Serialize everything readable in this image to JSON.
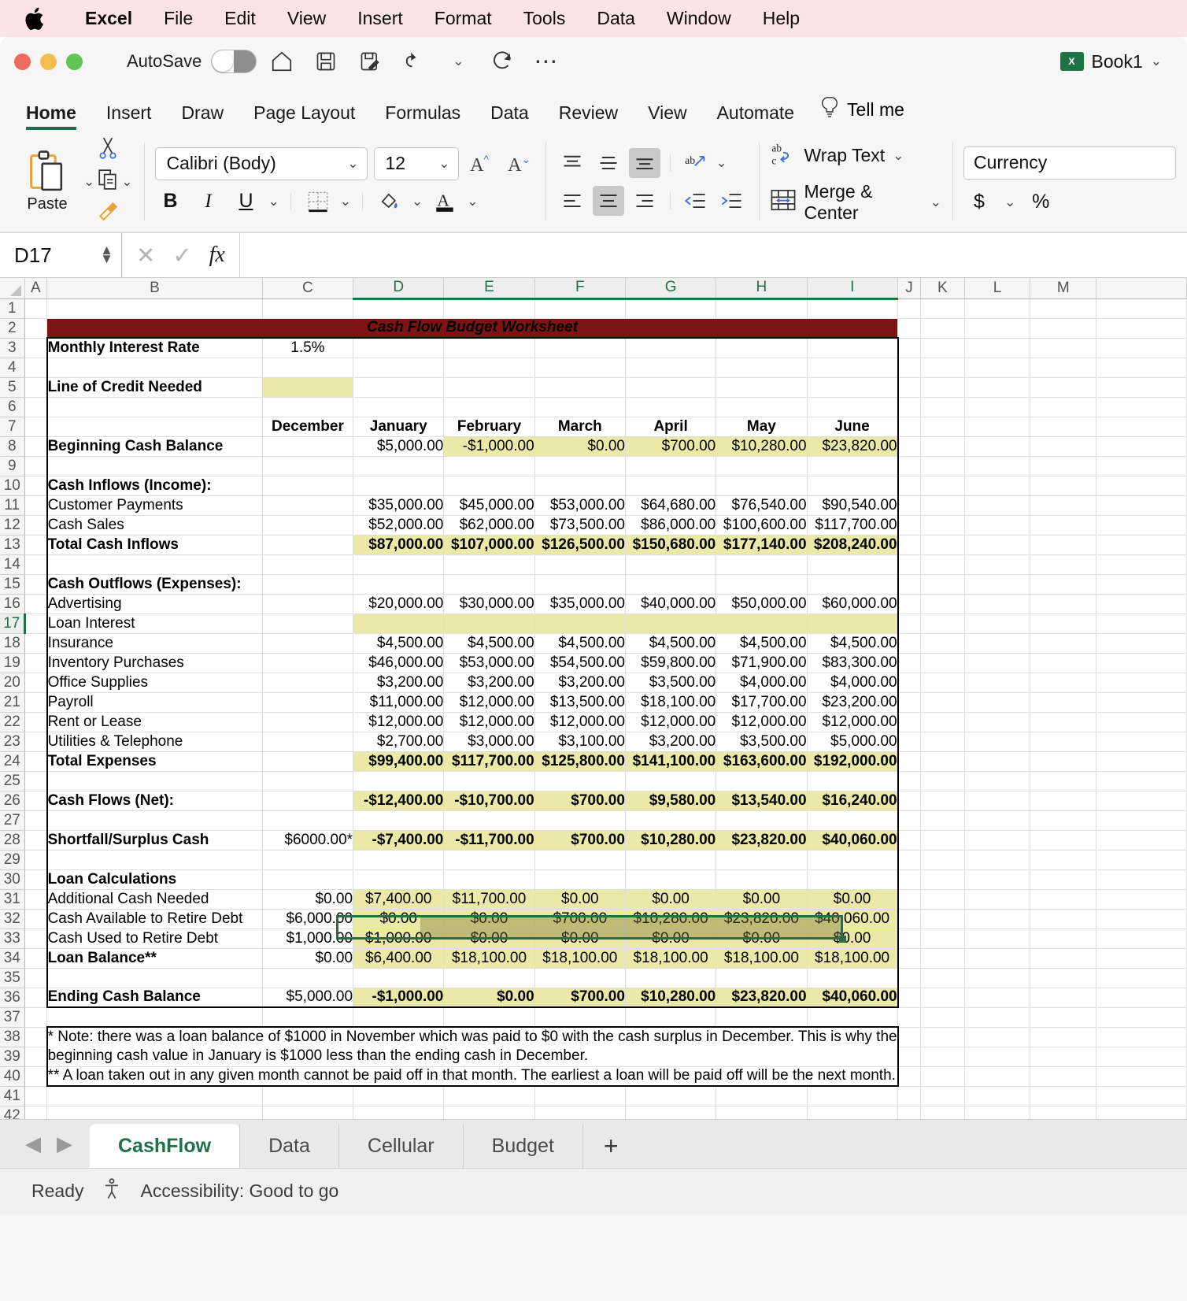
{
  "macmenu": {
    "apple_icon": "apple-logo-icon",
    "items": [
      "Excel",
      "File",
      "Edit",
      "View",
      "Insert",
      "Format",
      "Tools",
      "Data",
      "Window",
      "Help"
    ]
  },
  "quick_access": {
    "autosave_label": "AutoSave",
    "autosave_state": "off",
    "icons": [
      "home-icon",
      "save-icon",
      "save-as-icon",
      "undo-icon",
      "undo-dropdown-icon",
      "redo-icon",
      "more-options-icon"
    ],
    "workbook_name": "Book1",
    "workbook_badge": "X",
    "workbook_dropdown": "chevron-down-icon"
  },
  "ribbon": {
    "tabs": [
      "Home",
      "Insert",
      "Draw",
      "Page Layout",
      "Formulas",
      "Data",
      "Review",
      "View",
      "Automate"
    ],
    "active_tab": "Home",
    "tell_me": "Tell me",
    "clipboard": {
      "paste_label": "Paste",
      "cut": "scissors-icon",
      "copy": "copy-icon",
      "format_painter": "format-painter-icon"
    },
    "font": {
      "family": "Calibri (Body)",
      "size": "12",
      "grow": "A^",
      "shrink": "Av",
      "bold": "B",
      "italic": "I",
      "underline": "U",
      "borders": "borders-icon",
      "fill": "fill-color-icon",
      "font_color": "font-color-icon"
    },
    "alignment": {
      "top": "align-top-icon",
      "middle": "align-middle-icon",
      "bottom": "align-bottom-icon",
      "left": "align-left-icon",
      "center": "align-center-icon",
      "right": "align-right-icon",
      "orientation": "text-orientation-icon",
      "decrease_indent": "decrease-indent-icon",
      "increase_indent": "increase-indent-icon",
      "wrap_text": "Wrap Text",
      "merge_center": "Merge & Center"
    },
    "number": {
      "format": "Currency",
      "accounting": "$",
      "percent": "%"
    }
  },
  "formula_bar": {
    "name_box": "D17",
    "cancel": "cancel-icon",
    "enter": "confirm-icon",
    "fx": "fx",
    "value": ""
  },
  "grid": {
    "columns": [
      "A",
      "B",
      "C",
      "D",
      "E",
      "F",
      "G",
      "H",
      "I",
      "J",
      "K",
      "L",
      "M"
    ],
    "selected_columns": [
      "D",
      "E",
      "F",
      "G",
      "H",
      "I"
    ],
    "selected_row": "17",
    "title": "Cash Flow Budget Worksheet",
    "row_numbers": [
      "1",
      "2",
      "3",
      "4",
      "5",
      "6",
      "7",
      "8",
      "9",
      "10",
      "11",
      "12",
      "13",
      "14",
      "15",
      "16",
      "17",
      "18",
      "19",
      "20",
      "21",
      "22",
      "23",
      "24",
      "25",
      "26",
      "27",
      "28",
      "29",
      "30",
      "31",
      "32",
      "33",
      "34",
      "35",
      "36",
      "37",
      "38",
      "39",
      "40",
      "41",
      "42"
    ],
    "labels": {
      "monthly_interest_rate": "Monthly Interest Rate",
      "line_of_credit_needed": "Line of Credit Needed",
      "beginning_cash_balance": "Beginning Cash Balance",
      "cash_inflows": "Cash Inflows (Income):",
      "customer_payments": "Customer Payments",
      "cash_sales": "Cash Sales",
      "total_cash_inflows": "Total Cash Inflows",
      "cash_outflows": "Cash Outflows (Expenses):",
      "advertising": "Advertising",
      "loan_interest": "Loan Interest",
      "insurance": "Insurance",
      "inventory_purchases": "Inventory Purchases",
      "office_supplies": "Office Supplies",
      "payroll": "Payroll",
      "rent_or_lease": "Rent or Lease",
      "utilities_telephone": "Utilities & Telephone",
      "total_expenses": "Total Expenses",
      "cash_flows_net": "Cash Flows (Net):",
      "shortfall_surplus": "Shortfall/Surplus Cash",
      "loan_calculations": "Loan Calculations",
      "additional_cash_needed": "Additional Cash Needed",
      "cash_available_retire": "Cash Available to Retire Debt",
      "cash_used_retire": "Cash Used to Retire Debt",
      "loan_balance": "Loan Balance**",
      "ending_cash_balance": "Ending Cash Balance"
    },
    "month_headers": [
      "December",
      "January",
      "February",
      "March",
      "April",
      "May",
      "June"
    ],
    "interest_rate_value": "1.5%",
    "notes": [
      "* Note: there was a loan balance of $1000 in November which was paid to $0 with the cash surplus in December. This is why the",
      "beginning cash value in January is $1000 less than the ending cash in December.",
      "** A loan taken out in any given month cannot be paid off in that month. The earliest a loan will be paid off will be the next month."
    ]
  },
  "chart_data": {
    "type": "table",
    "title": "Cash Flow Budget Worksheet",
    "columns": [
      "December",
      "January",
      "February",
      "March",
      "April",
      "May",
      "June"
    ],
    "rows": [
      {
        "label": "Beginning Cash Balance",
        "values": [
          "",
          "$5,000.00",
          "-$1,000.00",
          "$0.00",
          "$700.00",
          "$10,280.00",
          "$23,820.00"
        ]
      },
      {
        "label": "Customer Payments",
        "values": [
          "",
          "$35,000.00",
          "$45,000.00",
          "$53,000.00",
          "$64,680.00",
          "$76,540.00",
          "$90,540.00"
        ]
      },
      {
        "label": "Cash Sales",
        "values": [
          "",
          "$52,000.00",
          "$62,000.00",
          "$73,500.00",
          "$86,000.00",
          "$100,600.00",
          "$117,700.00"
        ]
      },
      {
        "label": "Total Cash Inflows",
        "values": [
          "",
          "$87,000.00",
          "$107,000.00",
          "$126,500.00",
          "$150,680.00",
          "$177,140.00",
          "$208,240.00"
        ]
      },
      {
        "label": "Advertising",
        "values": [
          "",
          "$20,000.00",
          "$30,000.00",
          "$35,000.00",
          "$40,000.00",
          "$50,000.00",
          "$60,000.00"
        ]
      },
      {
        "label": "Loan Interest",
        "values": [
          "",
          "",
          "",
          "",
          "",
          "",
          ""
        ]
      },
      {
        "label": "Insurance",
        "values": [
          "",
          "$4,500.00",
          "$4,500.00",
          "$4,500.00",
          "$4,500.00",
          "$4,500.00",
          "$4,500.00"
        ]
      },
      {
        "label": "Inventory Purchases",
        "values": [
          "",
          "$46,000.00",
          "$53,000.00",
          "$54,500.00",
          "$59,800.00",
          "$71,900.00",
          "$83,300.00"
        ]
      },
      {
        "label": "Office Supplies",
        "values": [
          "",
          "$3,200.00",
          "$3,200.00",
          "$3,200.00",
          "$3,500.00",
          "$4,000.00",
          "$4,000.00"
        ]
      },
      {
        "label": "Payroll",
        "values": [
          "",
          "$11,000.00",
          "$12,000.00",
          "$13,500.00",
          "$18,100.00",
          "$17,700.00",
          "$23,200.00"
        ]
      },
      {
        "label": "Rent or Lease",
        "values": [
          "",
          "$12,000.00",
          "$12,000.00",
          "$12,000.00",
          "$12,000.00",
          "$12,000.00",
          "$12,000.00"
        ]
      },
      {
        "label": "Utilities & Telephone",
        "values": [
          "",
          "$2,700.00",
          "$3,000.00",
          "$3,100.00",
          "$3,200.00",
          "$3,500.00",
          "$5,000.00"
        ]
      },
      {
        "label": "Total Expenses",
        "values": [
          "",
          "$99,400.00",
          "$117,700.00",
          "$125,800.00",
          "$141,100.00",
          "$163,600.00",
          "$192,000.00"
        ]
      },
      {
        "label": "Cash Flows (Net):",
        "values": [
          "",
          "-$12,400.00",
          "-$10,700.00",
          "$700.00",
          "$9,580.00",
          "$13,540.00",
          "$16,240.00"
        ]
      },
      {
        "label": "Shortfall/Surplus Cash",
        "values": [
          "$6000.00*",
          "-$7,400.00",
          "-$11,700.00",
          "$700.00",
          "$10,280.00",
          "$23,820.00",
          "$40,060.00"
        ]
      },
      {
        "label": "Additional Cash Needed",
        "values": [
          "$0.00",
          "$7,400.00",
          "$11,700.00",
          "$0.00",
          "$0.00",
          "$0.00",
          "$0.00"
        ]
      },
      {
        "label": "Cash Available to Retire Debt",
        "values": [
          "$6,000.00",
          "$0.00",
          "$0.00",
          "$700.00",
          "$10,280.00",
          "$23,820.00",
          "$40,060.00"
        ]
      },
      {
        "label": "Cash Used to Retire Debt",
        "values": [
          "$1,000.00",
          "$1,000.00",
          "$0.00",
          "$0.00",
          "$0.00",
          "$0.00",
          "$0.00"
        ]
      },
      {
        "label": "Loan Balance**",
        "values": [
          "$0.00",
          "$6,400.00",
          "$18,100.00",
          "$18,100.00",
          "$18,100.00",
          "$18,100.00",
          "$18,100.00"
        ]
      },
      {
        "label": "Ending Cash Balance",
        "values": [
          "$5,000.00",
          "-$1,000.00",
          "$0.00",
          "$700.00",
          "$10,280.00",
          "$23,820.00",
          "$40,060.00"
        ]
      }
    ],
    "monthly_interest_rate": "1.5%"
  },
  "sheet_tabs": {
    "prev": "prev-sheet-icon",
    "next": "next-sheet-icon",
    "tabs": [
      "CashFlow",
      "Data",
      "Cellular",
      "Budget"
    ],
    "active": "CashFlow",
    "add": "+"
  },
  "status_bar": {
    "ready": "Ready",
    "accessibility": "Accessibility: Good to go",
    "accessibility_icon": "accessibility-icon"
  },
  "colors": {
    "title_band": "#7d1414",
    "highlight_yellow": "#ece9a8",
    "accent_green": "#1f7246",
    "menu_bar": "#fbe3e8"
  }
}
